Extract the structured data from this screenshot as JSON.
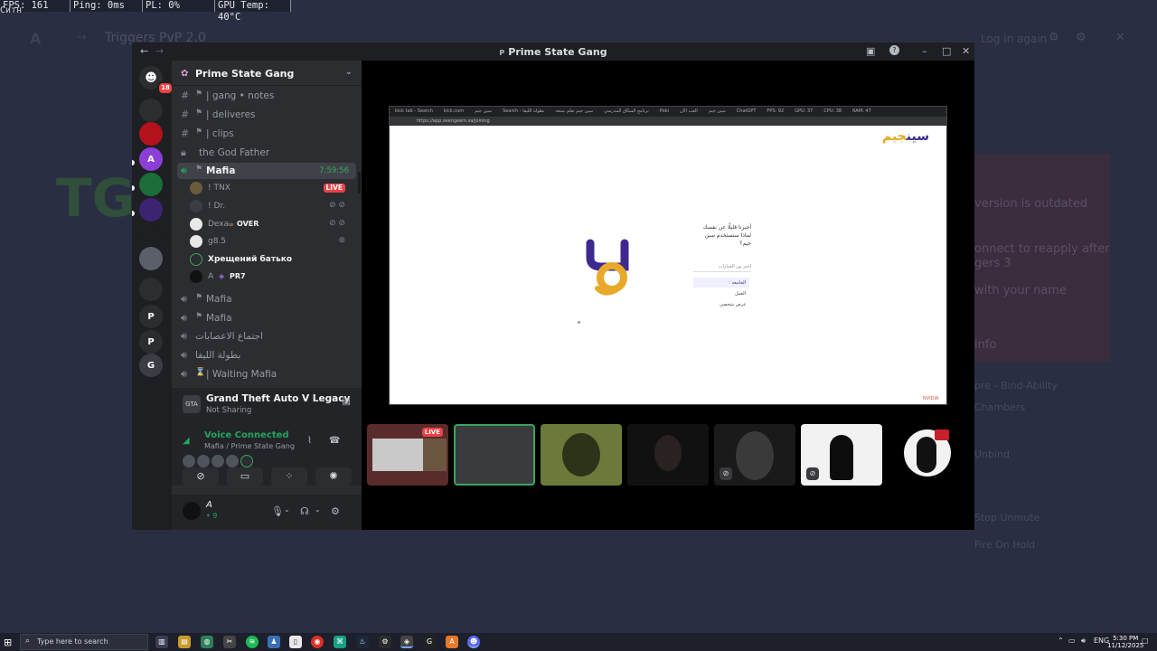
{
  "overlay": {
    "tag": "Ситн",
    "fps": "FPS: 161",
    "ping": "Ping: 0ms",
    "pl": "PL: 0%",
    "gpu": "GPU Temp: 40°C"
  },
  "background_app": {
    "title": "Triggers PvP 2.0",
    "logo": "A",
    "account": "Log in again",
    "notice": "version is outdated",
    "line1": "onnect to reapply after",
    "line2": "gers 3",
    "line3": "with your name",
    "line4": "info",
    "side1": "pre - Bind-Ability",
    "side2": "Chambers",
    "side3": "Unbind",
    "side4": "Stop Unmute",
    "side5": "Fire On Hold"
  },
  "window": {
    "title": "Prime State Gang",
    "back": "←",
    "forward": "→",
    "title_icon": "P"
  },
  "servers": {
    "home_badge": "18",
    "items": [
      {
        "label": "",
        "color": "#2b2d31"
      },
      {
        "label": "",
        "color": "#b3121d"
      },
      {
        "label": "A",
        "color": "#8b3fd6"
      },
      {
        "label": "",
        "color": "#1d6d3b"
      },
      {
        "label": "",
        "color": "#3b2470"
      },
      {
        "label": "",
        "color": "#1e1f22"
      },
      {
        "label": "",
        "color": "#5a5f6a"
      },
      {
        "label": "",
        "color": "#2b2d31"
      },
      {
        "label": "P",
        "color": "#2b2d31"
      },
      {
        "label": "P",
        "color": "#2b2d31"
      },
      {
        "label": "G",
        "color": "#3a3d44"
      }
    ]
  },
  "guild": {
    "name": "Prime State Gang"
  },
  "channels": {
    "gang_notes": "| gang • notes",
    "deliveres": "| deliveres",
    "clips": "| clips",
    "god_father": "the God Father",
    "mafia_active": "Mafia",
    "mafia_active_time": "7:59:56",
    "voice_users": [
      {
        "name": "! TNX",
        "live": "LIVE"
      },
      {
        "name": "! Dr."
      },
      {
        "name": "Dexa",
        "tag": "OVER"
      },
      {
        "name": "g8.5"
      },
      {
        "name": "Хрещений батько"
      },
      {
        "name": "A",
        "tag": "PR7"
      }
    ],
    "mafia_2": "Mafia",
    "mafia_3": "Mafia",
    "arabic_1": "اجتماع الاعصابات",
    "arabic_2": "بطولة الليفا",
    "waiting": "| Waiting Mafia"
  },
  "activity": {
    "title": "Grand Theft Auto V Legacy",
    "subtitle": "Not Sharing",
    "art": "GTA"
  },
  "voice": {
    "status": "Voice Connected",
    "channel": "Mafia / Prime State Gang"
  },
  "user": {
    "name": "A",
    "sub": "• 9"
  },
  "shared_screen": {
    "tabs": [
      "kick tab - Search",
      "kick.com",
      "سين جيم",
      "Search - بطولة الليفا",
      "سين جيم تعلم بمتعة",
      "برنامج السبّاق المدرسي",
      "Poki",
      "العب الآن",
      "سين جيم",
      "ChatGPT",
      "FPS: 92",
      "GPU: 37",
      "CPU: 38",
      "RAM: 47"
    ],
    "url": "https://app.seengeem.sa/joining",
    "brand_a": "سين",
    "brand_b": "جيم",
    "question_line1": "أخبرنا قليلًا عن نفسك",
    "question_line2": "لماذا ستستخدم سين",
    "question_line3": "جيم؟",
    "select_placeholder": "اختر من الخيارات",
    "options": [
      "الجامعة",
      "العمل",
      "غرض شخصي"
    ],
    "watermark": "NVIDIA"
  },
  "tiles": [
    {
      "kind": "screen",
      "live": "LIVE"
    },
    {
      "kind": "selected"
    },
    {
      "kind": "avatar",
      "color": "#6b7a3a"
    },
    {
      "kind": "dark"
    },
    {
      "kind": "dark-mute"
    },
    {
      "kind": "white-silhouette"
    },
    {
      "kind": "red-avatar"
    }
  ],
  "taskbar": {
    "search_placeholder": "Type here to search",
    "lang": "ENG",
    "time": "5:30 PM",
    "date": "11/12/2025"
  }
}
